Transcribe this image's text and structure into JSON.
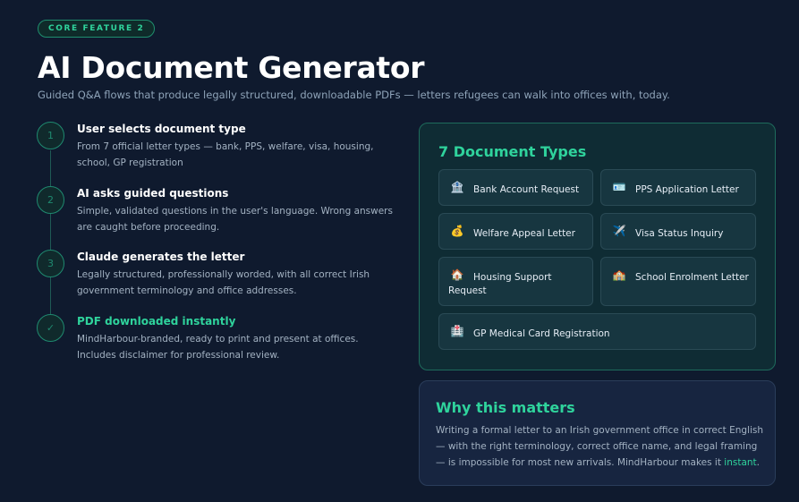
{
  "badge": "CORE FEATURE 2",
  "title": "AI Document Generator",
  "subtitle": "Guided Q&A flows that produce legally structured, downloadable PDFs — letters refugees can walk into offices with, today.",
  "steps": [
    {
      "marker": "1",
      "title": "User selects document type",
      "desc": "From 7 official letter types — bank, PPS, welfare, visa, housing, school, GP registration"
    },
    {
      "marker": "2",
      "title": "AI asks guided questions",
      "desc": "Simple, validated questions in the user's language. Wrong answers are caught before proceeding."
    },
    {
      "marker": "3",
      "title": "Claude generates the letter",
      "desc": "Legally structured, professionally worded, with all correct Irish government terminology and office addresses."
    },
    {
      "marker": "✓",
      "title": "PDF downloaded instantly",
      "desc": "MindHarbour-branded, ready to print and present at offices. Includes disclaimer for professional review."
    }
  ],
  "doc_types": {
    "title": "7 Document Types",
    "items": [
      {
        "icon": "🏦",
        "icon_name": "bank-icon",
        "label": "Bank Account Request"
      },
      {
        "icon": "🪪",
        "icon_name": "id-card-icon",
        "label": "PPS Application Letter"
      },
      {
        "icon": "💰",
        "icon_name": "money-bag-icon",
        "label": "Welfare Appeal Letter"
      },
      {
        "icon": "✈️",
        "icon_name": "airplane-icon",
        "label": "Visa Status Inquiry"
      },
      {
        "icon": "🏠",
        "icon_name": "house-icon",
        "label": "Housing Support Request"
      },
      {
        "icon": "🏫",
        "icon_name": "school-icon",
        "label": "School Enrolment Letter"
      },
      {
        "icon": "🏥",
        "icon_name": "medical-icon",
        "label": "GP Medical Card Registration"
      }
    ]
  },
  "why": {
    "title": "Why this matters",
    "text": "Writing a formal letter to an Irish government office in correct English — with the right terminology, correct office name, and legal framing — is impossible for most new arrivals. MindHarbour makes it ",
    "highlight": "instant",
    "end": "."
  },
  "colors": {
    "accent": "#2fd39c",
    "background": "#0f1a2e",
    "card": "#0f2c34"
  }
}
